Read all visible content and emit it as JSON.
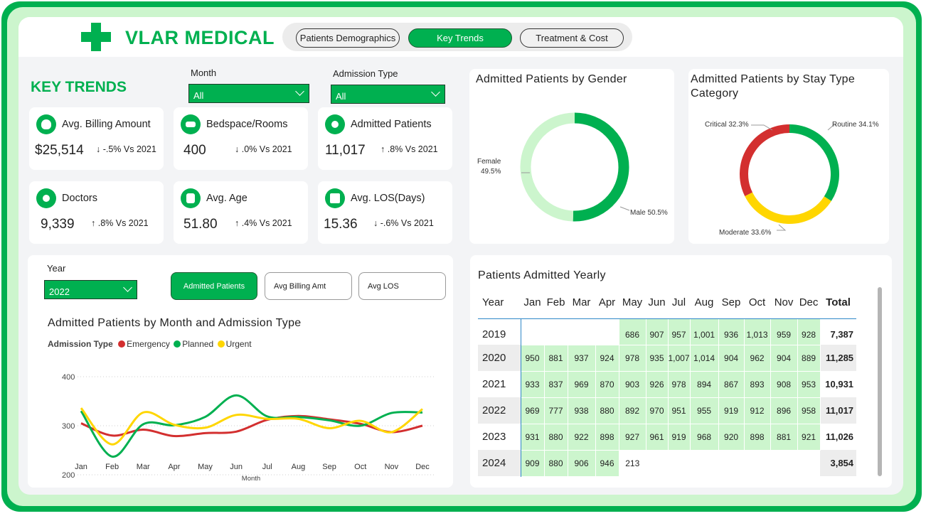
{
  "brand": {
    "name": "VLAR MEDICAL"
  },
  "nav": {
    "tabs": [
      "Patients Demographics",
      "Key Trends",
      "Treatment & Cost"
    ],
    "active": "Key Trends"
  },
  "colors": {
    "accent": "#00b050",
    "emergency": "#d32f2f",
    "planned": "#00b050",
    "urgent": "#ffd600",
    "cell_fill": "#ccf5cd",
    "male": "#00b050",
    "female": "#ccf5cd"
  },
  "page": {
    "title": "KEY TRENDS"
  },
  "filters": {
    "month": {
      "label": "Month",
      "value": "All"
    },
    "admission_type": {
      "label": "Admission Type",
      "value": "All"
    }
  },
  "kpis": [
    {
      "label": "Avg. Billing Amount",
      "value": "$25,514",
      "delta": "↓ -.5% Vs 2021",
      "icon": "money-bag-icon"
    },
    {
      "label": "Bedspace/Rooms",
      "value": "400",
      "delta": "↓ .0% Vs 2021",
      "icon": "bed-icon"
    },
    {
      "label": "Admitted Patients",
      "value": "11,017",
      "delta": "↑ .8% Vs 2021",
      "icon": "patient-icon"
    },
    {
      "label": "Doctors",
      "value": "9,339",
      "delta": "↑ .8% Vs 2021",
      "icon": "doctor-icon"
    },
    {
      "label": "Avg. Age",
      "value": "51.80",
      "delta": "↑ .4% Vs 2021",
      "icon": "family-icon"
    },
    {
      "label": "Avg. LOS(Days)",
      "value": "15.36",
      "delta": "↓ -.6% Vs 2021",
      "icon": "calendar-icon"
    }
  ],
  "gender_chart": {
    "title": "Admitted Patients by Gender",
    "labels": {
      "female_name": "Female",
      "female_pct": "49.5%",
      "male": "Male 50.5%"
    }
  },
  "stay_chart": {
    "title_line1": "Admitted Patients by Stay Type",
    "title_line2": "Category",
    "labels": {
      "critical": "Critical 32.3%",
      "routine": "Routine 34.1%",
      "moderate": "Moderate 33.6%"
    }
  },
  "trend_panel": {
    "year_label": "Year",
    "year_value": "2022",
    "buttons": [
      "Admitted Patients",
      "Avg Billing Amt",
      "Avg LOS"
    ],
    "title": "Admitted Patients by Month and Admission Type",
    "legend_title": "Admission Type",
    "legend": [
      "Emergency",
      "Planned",
      "Urgent"
    ],
    "x_axis_title": "Month"
  },
  "chart_data": [
    {
      "type": "pie",
      "title": "Admitted Patients by Gender",
      "labels": [
        "Male",
        "Female"
      ],
      "values": [
        50.5,
        49.5
      ]
    },
    {
      "type": "pie",
      "title": "Admitted Patients by Stay Type Category",
      "labels": [
        "Routine",
        "Moderate",
        "Critical"
      ],
      "values": [
        34.1,
        33.6,
        32.3
      ]
    },
    {
      "type": "line",
      "title": "Admitted Patients by Month and Admission Type",
      "xlabel": "Month",
      "ylabel": "",
      "ylim": [
        200,
        400
      ],
      "yticks": [
        200,
        300,
        400
      ],
      "categories": [
        "Jan",
        "Feb",
        "Mar",
        "Apr",
        "May",
        "Jun",
        "Jul",
        "Aug",
        "Sep",
        "Oct",
        "Nov",
        "Dec"
      ],
      "series": [
        {
          "name": "Emergency",
          "values": [
            305,
            280,
            292,
            279,
            285,
            288,
            312,
            320,
            313,
            304,
            287,
            300
          ]
        },
        {
          "name": "Planned",
          "values": [
            330,
            237,
            303,
            301,
            318,
            362,
            319,
            318,
            311,
            300,
            326,
            327
          ]
        },
        {
          "name": "Urgent",
          "values": [
            336,
            262,
            327,
            302,
            296,
            322,
            314,
            314,
            295,
            310,
            287,
            334
          ]
        }
      ]
    },
    {
      "type": "table",
      "title": "Patients Admitted Yearly",
      "columns": [
        "Year",
        "Jan",
        "Feb",
        "Mar",
        "Apr",
        "May",
        "Jun",
        "Jul",
        "Aug",
        "Sep",
        "Oct",
        "Nov",
        "Dec",
        "Total"
      ],
      "rows": [
        [
          "2019",
          "",
          "",
          "",
          "",
          "686",
          "907",
          "957",
          "1,001",
          "936",
          "1,013",
          "959",
          "928",
          "7,387"
        ],
        [
          "2020",
          "950",
          "881",
          "937",
          "924",
          "978",
          "935",
          "1,007",
          "1,014",
          "904",
          "962",
          "904",
          "889",
          "11,285"
        ],
        [
          "2021",
          "933",
          "837",
          "969",
          "870",
          "903",
          "926",
          "978",
          "894",
          "867",
          "893",
          "908",
          "953",
          "10,931"
        ],
        [
          "2022",
          "969",
          "777",
          "938",
          "880",
          "892",
          "970",
          "951",
          "955",
          "919",
          "912",
          "896",
          "958",
          "11,017"
        ],
        [
          "2023",
          "931",
          "880",
          "922",
          "898",
          "927",
          "961",
          "919",
          "968",
          "920",
          "898",
          "881",
          "921",
          "11,026"
        ],
        [
          "2024",
          "909",
          "880",
          "906",
          "946",
          "213",
          "",
          "",
          "",
          "",
          "",
          "",
          "",
          "3,854"
        ]
      ]
    }
  ]
}
